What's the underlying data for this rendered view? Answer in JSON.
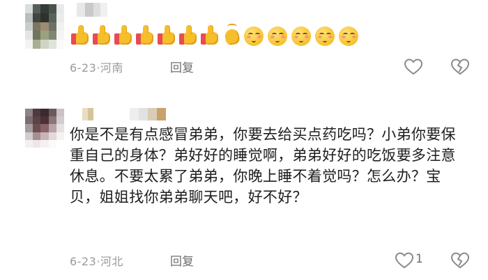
{
  "comments": [
    {
      "date": "6-23",
      "separator": "·",
      "location": "河南",
      "reply_label": "回复",
      "emoji": [
        "thumbs-up",
        "thumbs-up",
        "thumbs-up",
        "thumbs-up",
        "thumbs-up",
        "thumbs-up",
        "thumbs-up",
        "clapping-hands",
        "shy-face",
        "shy-face",
        "shy-face",
        "shy-face",
        "shy-face"
      ]
    },
    {
      "date": "6-23",
      "separator": "·",
      "location": "河北",
      "reply_label": "回复",
      "like_count": "1",
      "text": "你是不是有点感冒弟弟，你要去给买点药吃吗？小弟你要保重自己的身体？弟好好的睡觉啊，弟弟好好的吃饭要多注意休息。不要太累了弟弟，你晚上睡不着觉吗？怎么办？宝贝，姐姐找你弟弟聊天吧，好不好？"
    }
  ],
  "colors": {
    "meta_text": "#9a9a9a",
    "reply_text": "#6f6f6f",
    "body_text": "#1e1e1e",
    "thumb": "#f7be2c",
    "cuff": "#e74c50",
    "icon_stroke": "#8a8a8a"
  }
}
